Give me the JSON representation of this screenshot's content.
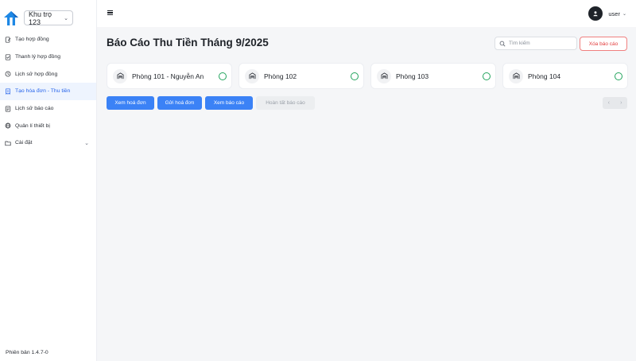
{
  "sidebar": {
    "area_select": {
      "value": "Khu trọ 123"
    },
    "items": [
      {
        "label": "Tạo hợp đồng",
        "icon": "file-edit-icon"
      },
      {
        "label": "Thanh lý hợp đồng",
        "icon": "file-check-icon"
      },
      {
        "label": "Lịch sử hợp đồng",
        "icon": "history-icon"
      },
      {
        "label": "Tạo hóa đơn - Thu tiền",
        "icon": "receipt-icon",
        "active": true
      },
      {
        "label": "Lịch sử báo cáo",
        "icon": "file-list-icon"
      },
      {
        "label": "Quản lí thiết bị",
        "icon": "globe-icon"
      },
      {
        "label": "Cài đặt",
        "icon": "settings-folder-icon",
        "expandable": true
      }
    ],
    "version": "Phiên bản 1.4.7-0"
  },
  "topbar": {
    "user_name": "user"
  },
  "main": {
    "title": "Báo Cáo Thu Tiền Tháng 9/2025",
    "search_placeholder": "Tìm kiếm",
    "delete_report_label": "Xóa báo cáo",
    "rooms": [
      {
        "name": "Phòng 101 - Nguyễn An"
      },
      {
        "name": "Phòng 102"
      },
      {
        "name": "Phòng 103"
      },
      {
        "name": "Phòng 104"
      }
    ],
    "actions": {
      "view_invoice": "Xem hoá đơn",
      "send_invoice": "Gửi hoá đơn",
      "view_report": "Xem báo cáo",
      "complete_report": "Hoàn tất báo cáo"
    },
    "pager": {
      "prev": "‹",
      "next": "›"
    }
  },
  "colors": {
    "accent": "#3b82f6",
    "active_bg": "#eef4fe",
    "danger": "#e23b3b",
    "status_ok": "#22a45d"
  }
}
